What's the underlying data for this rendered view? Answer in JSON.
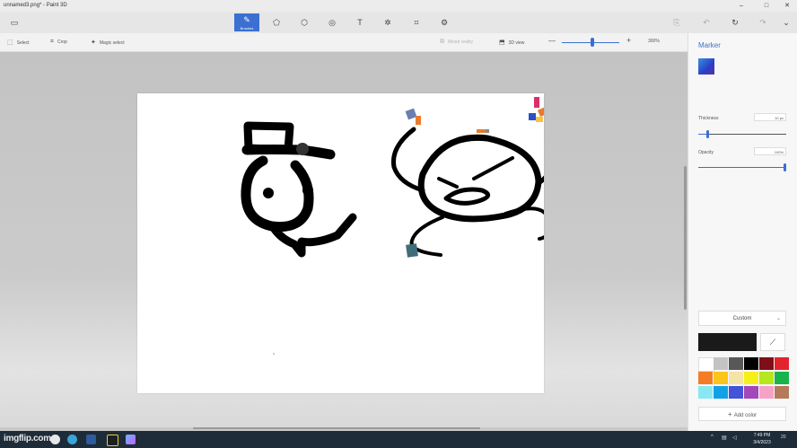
{
  "window": {
    "title": "unnamed3.png* - Paint 3D",
    "minimize": "–",
    "maximize": "□",
    "close": "✕"
  },
  "ribbon": {
    "items": [
      {
        "name": "menu",
        "glyph": "▭",
        "label": ""
      },
      {
        "name": "brushes",
        "glyph": "✎",
        "label": "Brushes"
      },
      {
        "name": "2d-shapes",
        "glyph": "⬠",
        "label": ""
      },
      {
        "name": "3d-shapes",
        "glyph": "⬡",
        "label": ""
      },
      {
        "name": "stickers",
        "glyph": "◎",
        "label": ""
      },
      {
        "name": "text",
        "glyph": "T",
        "label": ""
      },
      {
        "name": "effects",
        "glyph": "✲",
        "label": ""
      },
      {
        "name": "canvas",
        "glyph": "⌗",
        "label": ""
      },
      {
        "name": "3d-library",
        "glyph": "⚙",
        "label": ""
      },
      {
        "name": "paste",
        "glyph": "⎘",
        "label": ""
      },
      {
        "name": "undo",
        "glyph": "↶",
        "label": ""
      },
      {
        "name": "history",
        "glyph": "↻",
        "label": ""
      },
      {
        "name": "redo",
        "glyph": "↷",
        "label": ""
      },
      {
        "name": "more",
        "glyph": "⌄",
        "label": ""
      }
    ]
  },
  "toolbar": {
    "select": "Select",
    "crop": "Crop",
    "magic_select": "Magic select",
    "mixed_reality": "Mixed reality",
    "view_3d": "3D view",
    "zoom_out": "—",
    "zoom_in": "+",
    "zoom": "300%"
  },
  "panel": {
    "title": "Marker",
    "thickness_label": "Thickness",
    "thickness_value": "10 px",
    "opacity_label": "Opacity",
    "opacity_value": "100%",
    "opacity_level": 1.0,
    "thickness_level": 0.1,
    "color_mode": "Custom",
    "current_color": "#1a1a1a",
    "add_color": "Add color",
    "palette": [
      "#ffffff",
      "#c3c3c3",
      "#585858",
      "#000000",
      "#7e0e18",
      "#e3232c",
      "#f47d23",
      "#fbc51a",
      "#f5e4a6",
      "#f7ef1a",
      "#b6e61e",
      "#19b34c",
      "#8ae7f4",
      "#12a1e6",
      "#4354d8",
      "#a347ba",
      "#f5a2c8",
      "#b57a5a"
    ]
  },
  "taskbar": {
    "watermark": "imgflip.com",
    "time": "7:49 PM",
    "date": "3/4/2023",
    "tray_chevron": "^",
    "notification": "20"
  }
}
